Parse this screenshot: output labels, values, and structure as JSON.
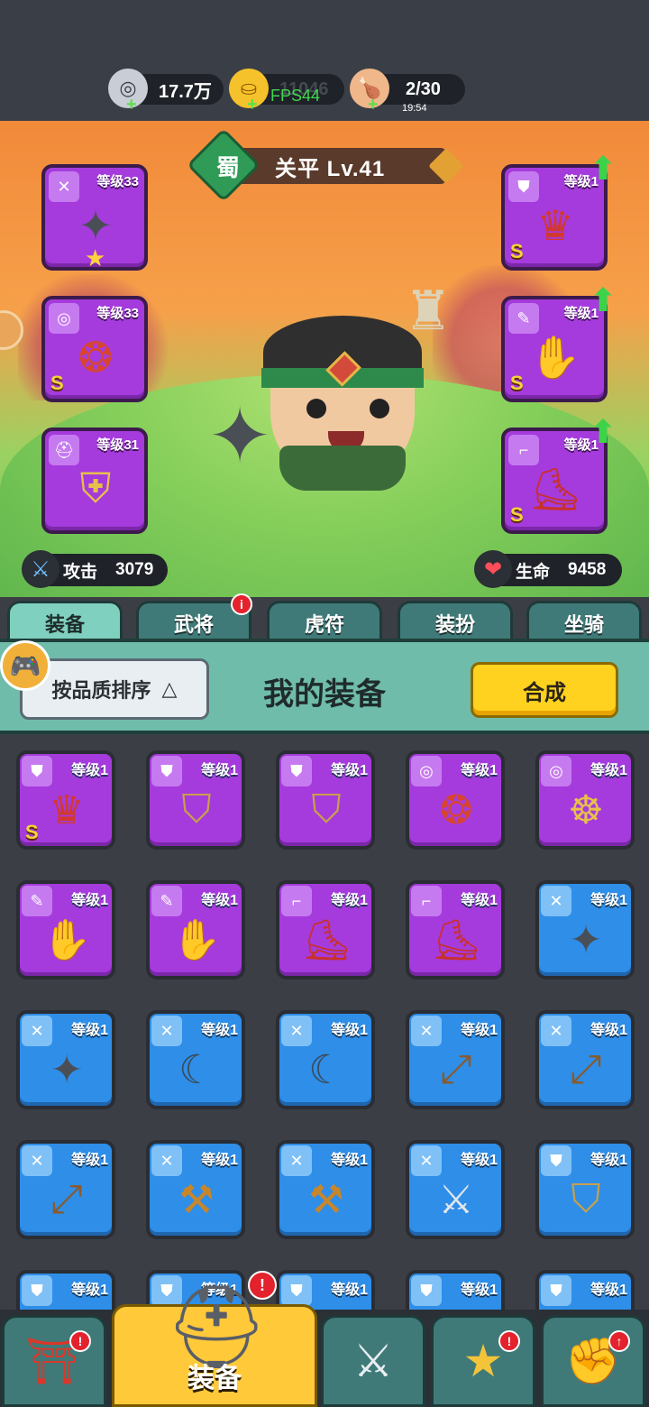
{
  "resources": {
    "silver": {
      "icon": "silver-coin-icon",
      "value": "17.7万"
    },
    "gold": {
      "icon": "gold-ingot-icon",
      "value": "11046"
    },
    "stamina": {
      "icon": "meat-drumstick-icon",
      "value": "2/30",
      "timer": "19:54"
    }
  },
  "fps_overlay": "FPS44",
  "hero": {
    "faction": "蜀",
    "name": "关平  Lv.41",
    "attack_label": "攻击",
    "attack_value": "3079",
    "hp_label": "生命",
    "hp_value": "9458"
  },
  "equipped": {
    "left": [
      {
        "level": "等级33",
        "art": "✦",
        "cat": "✕",
        "grade": "",
        "star": true
      },
      {
        "level": "等级33",
        "art": "❂",
        "cat": "◎",
        "grade": "S",
        "star": false
      },
      {
        "level": "等级31",
        "art": "⛨",
        "cat": "⛑",
        "grade": "",
        "star": false
      }
    ],
    "right": [
      {
        "level": "等级1",
        "art": "♛",
        "cat": "⛊",
        "grade": "S",
        "upgrade": true
      },
      {
        "level": "等级1",
        "art": "✋",
        "cat": "✎",
        "grade": "S",
        "upgrade": true
      },
      {
        "level": "等级1",
        "art": "⛸",
        "cat": "⌐",
        "grade": "S",
        "upgrade": true
      }
    ]
  },
  "tabs": [
    "装备",
    "武将",
    "虎符",
    "装扮",
    "坐骑"
  ],
  "active_tab": 0,
  "tab_badge": "i",
  "panel": {
    "sort_label": "按品质排序",
    "sort_icon": "△",
    "title": "我的装备",
    "combine_label": "合成"
  },
  "inventory": [
    {
      "color": "purple",
      "level": "等级1",
      "cat": "⛊",
      "art": "♛",
      "grade": "S"
    },
    {
      "color": "purple",
      "level": "等级1",
      "cat": "⛊",
      "art": "⛉",
      "grade": ""
    },
    {
      "color": "purple",
      "level": "等级1",
      "cat": "⛊",
      "art": "⛉",
      "grade": ""
    },
    {
      "color": "purple",
      "level": "等级1",
      "cat": "◎",
      "art": "❂",
      "grade": ""
    },
    {
      "color": "purple",
      "level": "等级1",
      "cat": "◎",
      "art": "☸",
      "grade": ""
    },
    {
      "color": "purple",
      "level": "等级1",
      "cat": "✎",
      "art": "✋",
      "grade": ""
    },
    {
      "color": "purple",
      "level": "等级1",
      "cat": "✎",
      "art": "✋",
      "grade": ""
    },
    {
      "color": "purple",
      "level": "等级1",
      "cat": "⌐",
      "art": "⛸",
      "grade": ""
    },
    {
      "color": "purple",
      "level": "等级1",
      "cat": "⌐",
      "art": "⛸",
      "grade": ""
    },
    {
      "color": "blue",
      "level": "等级1",
      "cat": "✕",
      "art": "✦",
      "grade": ""
    },
    {
      "color": "blue",
      "level": "等级1",
      "cat": "✕",
      "art": "✦",
      "grade": ""
    },
    {
      "color": "blue",
      "level": "等级1",
      "cat": "✕",
      "art": "☾",
      "grade": ""
    },
    {
      "color": "blue",
      "level": "等级1",
      "cat": "✕",
      "art": "☾",
      "grade": ""
    },
    {
      "color": "blue",
      "level": "等级1",
      "cat": "✕",
      "art": "⤢",
      "grade": ""
    },
    {
      "color": "blue",
      "level": "等级1",
      "cat": "✕",
      "art": "⤢",
      "grade": ""
    },
    {
      "color": "blue",
      "level": "等级1",
      "cat": "✕",
      "art": "⤢",
      "grade": ""
    },
    {
      "color": "blue",
      "level": "等级1",
      "cat": "✕",
      "art": "⚒",
      "grade": ""
    },
    {
      "color": "blue",
      "level": "等级1",
      "cat": "✕",
      "art": "⚒",
      "grade": ""
    },
    {
      "color": "blue",
      "level": "等级1",
      "cat": "✕",
      "art": "⚔",
      "grade": ""
    },
    {
      "color": "blue",
      "level": "等级1",
      "cat": "⛊",
      "art": "⛉",
      "grade": ""
    },
    {
      "color": "blue",
      "level": "等级1",
      "cat": "⛊",
      "art": "⛉",
      "grade": ""
    },
    {
      "color": "blue",
      "level": "等级1",
      "cat": "⛊",
      "art": "⛉",
      "grade": ""
    },
    {
      "color": "blue",
      "level": "等级1",
      "cat": "⛊",
      "art": "⛉",
      "grade": ""
    },
    {
      "color": "blue",
      "level": "等级1",
      "cat": "⛊",
      "art": "⛉",
      "grade": ""
    },
    {
      "color": "blue",
      "level": "等级1",
      "cat": "⛊",
      "art": "⛉",
      "grade": ""
    }
  ],
  "bottom_nav": [
    {
      "name": "shop-nav-button",
      "icon": "⛩",
      "label": "",
      "badge": "!"
    },
    {
      "name": "equipment-nav-button",
      "icon": "⛑",
      "label": "装备",
      "badge": "!",
      "active": true
    },
    {
      "name": "battle-nav-button",
      "icon": "⚔",
      "label": ""
    },
    {
      "name": "heroes-nav-button",
      "icon": "★",
      "label": "",
      "badge": "!"
    },
    {
      "name": "upgrade-nav-button",
      "icon": "✊",
      "label": "",
      "badge": "↑"
    }
  ],
  "colors": {
    "purple": "#a53bdc",
    "blue": "#2e8ee8",
    "accent": "#ffd21f",
    "tab": "#3f7a78",
    "tab_active": "#7fd0bf"
  }
}
